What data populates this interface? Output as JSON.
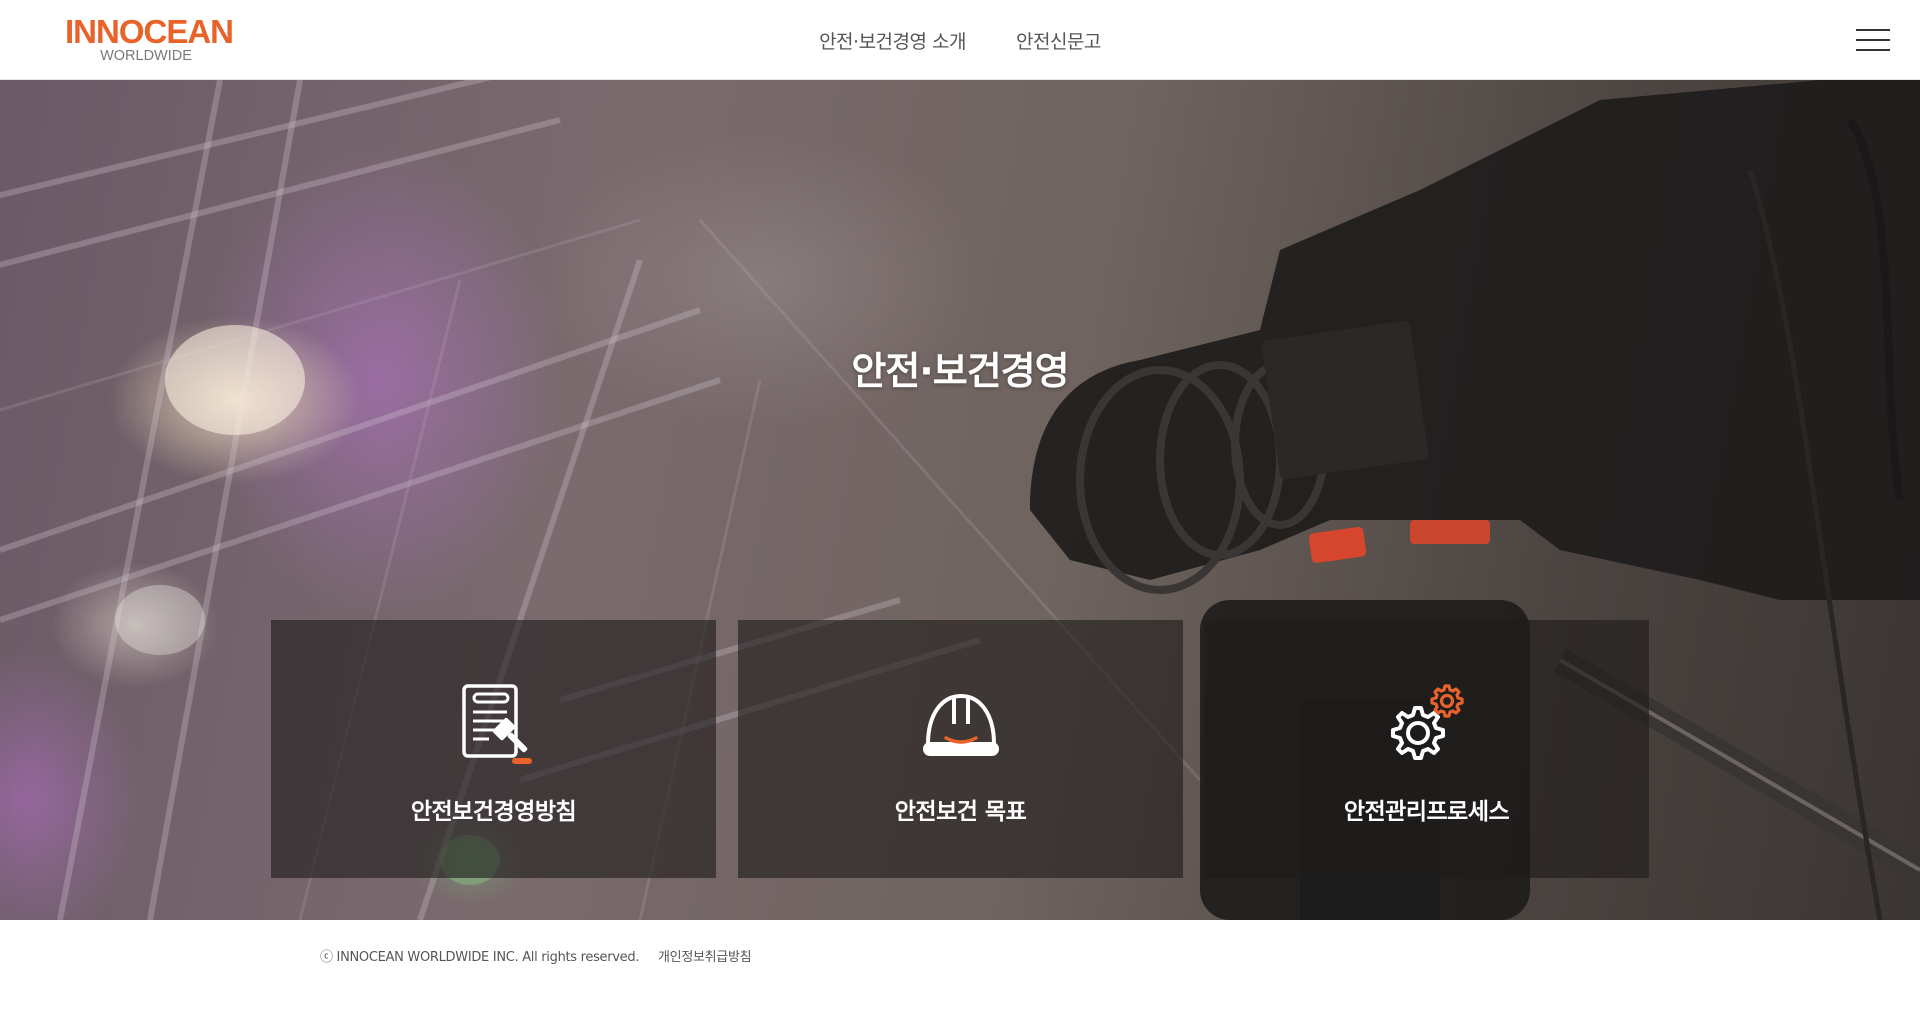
{
  "brand": {
    "name": "INNOCEAN",
    "subtitle": "WORLDWIDE",
    "accent_color": "#e8622a",
    "subtitle_color": "#7a7a7a"
  },
  "nav": {
    "items": [
      {
        "label": "안전·보건경영 소개"
      },
      {
        "label": "안전신문고"
      }
    ],
    "menu_icon": "hamburger-menu-icon"
  },
  "hero": {
    "title": "안전·보건경영",
    "background": "camera-on-tripod-concert-stage-photo",
    "cards": [
      {
        "label": "안전보건경영방침",
        "icon": "document-gavel-icon"
      },
      {
        "label": "안전보건 목표",
        "icon": "hard-hat-icon"
      },
      {
        "label": "안전관리프로세스",
        "icon": "gears-icon"
      }
    ]
  },
  "footer": {
    "copyright": "ⓒ INNOCEAN WORLDWIDE INC. All rights reserved.",
    "privacy_link": "개인정보취급방침"
  }
}
